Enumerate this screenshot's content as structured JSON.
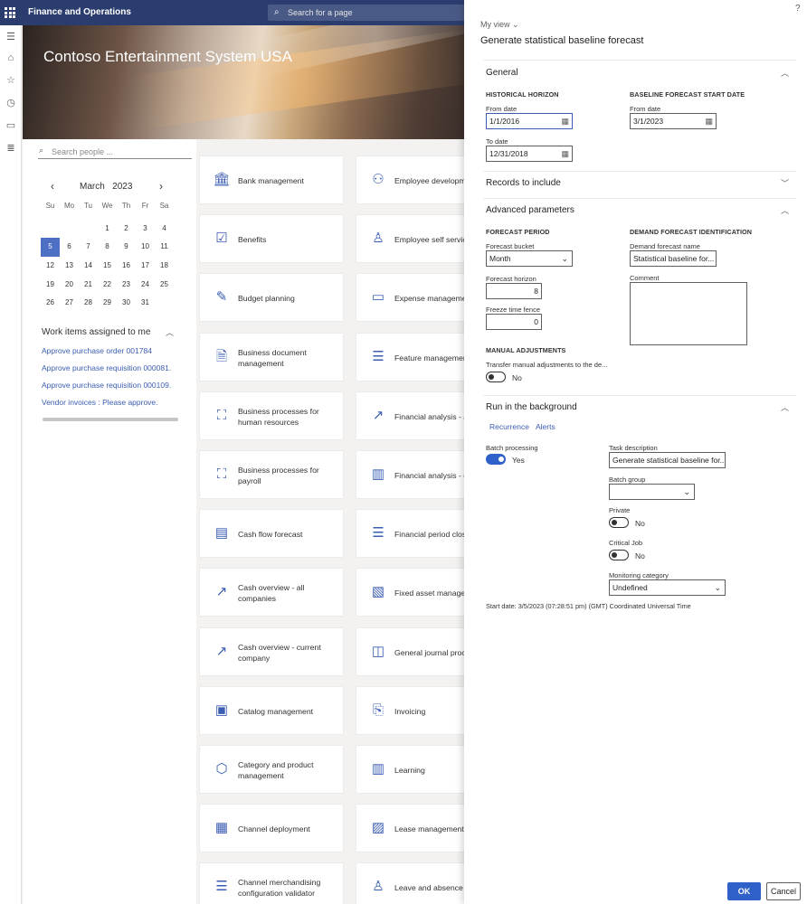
{
  "topbar": {
    "app_title": "Finance and Operations",
    "search_placeholder": "Search for a page"
  },
  "banner": {
    "title": "Contoso Entertainment System USA"
  },
  "people": {
    "placeholder": "Search people ..."
  },
  "calendar": {
    "month": "March",
    "year": "2023",
    "prev": "‹",
    "next": "›",
    "days": [
      "Su",
      "Mo",
      "Tu",
      "We",
      "Th",
      "Fr",
      "Sa"
    ],
    "cells": [
      "",
      "",
      "",
      "1",
      "2",
      "3",
      "4",
      "5",
      "6",
      "7",
      "8",
      "9",
      "10",
      "11",
      "12",
      "13",
      "14",
      "15",
      "16",
      "17",
      "18",
      "19",
      "20",
      "21",
      "22",
      "23",
      "24",
      "25",
      "26",
      "27",
      "28",
      "29",
      "30",
      "31",
      ""
    ],
    "selected": "5"
  },
  "work_items": {
    "title": "Work items assigned to me",
    "links": [
      "Approve purchase order 001784",
      "Approve purchase requisition 000081.",
      "Approve purchase requisition 000109.",
      "Vendor invoices : Please approve."
    ]
  },
  "tiles_col1": [
    {
      "label": "Bank management",
      "icon": "bank-icon"
    },
    {
      "label": "Benefits",
      "icon": "benefits-icon"
    },
    {
      "label": "Budget planning",
      "icon": "budget-icon"
    },
    {
      "label": "Business document management",
      "icon": "document-icon"
    },
    {
      "label": "Business processes for human resources",
      "icon": "process-icon"
    },
    {
      "label": "Business processes for payroll",
      "icon": "process-icon"
    },
    {
      "label": "Cash flow forecast",
      "icon": "cash-register-icon"
    },
    {
      "label": "Cash overview - all companies",
      "icon": "trend-icon"
    },
    {
      "label": "Cash overview - current company",
      "icon": "trend-icon"
    },
    {
      "label": "Catalog management",
      "icon": "catalog-icon"
    },
    {
      "label": "Category and product management",
      "icon": "product-icon"
    },
    {
      "label": "Channel deployment",
      "icon": "store-icon"
    },
    {
      "label": "Channel merchandising configuration validator",
      "icon": "checklist-icon"
    }
  ],
  "tiles_col2": [
    {
      "label": "Employee development",
      "icon": "people-icon"
    },
    {
      "label": "Employee self service",
      "icon": "person-icon"
    },
    {
      "label": "Expense management",
      "icon": "expense-icon"
    },
    {
      "label": "Feature management",
      "icon": "checklist-icon"
    },
    {
      "label": "Financial analysis - all companies",
      "icon": "trend-icon"
    },
    {
      "label": "Financial analysis - current company",
      "icon": "report-icon"
    },
    {
      "label": "Financial period close",
      "icon": "checklist-icon"
    },
    {
      "label": "Fixed asset management",
      "icon": "asset-icon"
    },
    {
      "label": "General journal processing",
      "icon": "journal-icon"
    },
    {
      "label": "Invoicing",
      "icon": "invoice-icon"
    },
    {
      "label": "Learning",
      "icon": "books-icon"
    },
    {
      "label": "Lease management",
      "icon": "lease-icon"
    },
    {
      "label": "Leave and absence",
      "icon": "person-icon"
    }
  ],
  "pane": {
    "help": "?",
    "my_view": "My view",
    "title": "Generate statistical baseline forecast",
    "general": {
      "header": "General",
      "historical_horizon": "HISTORICAL HORIZON",
      "from_date_label": "From date",
      "from_date": "1/1/2016",
      "to_date_label": "To date",
      "to_date": "12/31/2018",
      "baseline_start": "BASELINE FORECAST START DATE",
      "baseline_from_label": "From date",
      "baseline_from": "3/1/2023"
    },
    "records": {
      "header": "Records to include"
    },
    "advanced": {
      "header": "Advanced parameters",
      "forecast_period": "FORECAST PERIOD",
      "bucket_label": "Forecast bucket",
      "bucket": "Month",
      "horizon_label": "Forecast horizon",
      "horizon": "8",
      "fence_label": "Freeze time fence",
      "fence": "0",
      "demand_id": "DEMAND FORECAST IDENTIFICATION",
      "demand_name_label": "Demand forecast name",
      "demand_name": "Statistical baseline for...",
      "comment_label": "Comment",
      "manual_adj": "MANUAL ADJUSTMENTS",
      "transfer_label": "Transfer manual adjustments to the de...",
      "transfer_value": "No"
    },
    "background": {
      "header": "Run in the background",
      "tab_recurrence": "Recurrence",
      "tab_alerts": "Alerts",
      "batch_label": "Batch processing",
      "batch_value": "Yes",
      "task_label": "Task description",
      "task": "Generate statistical baseline for...",
      "batch_group_label": "Batch group",
      "batch_group": "",
      "private_label": "Private",
      "private_value": "No",
      "critical_label": "Critical Job",
      "critical_value": "No",
      "monitoring_label": "Monitoring category",
      "monitoring": "Undefined",
      "start_date": "Start date: 3/5/2023 (07:28:51 pm) (GMT) Coordinated Universal Time"
    },
    "ok": "OK",
    "cancel": "Cancel"
  }
}
